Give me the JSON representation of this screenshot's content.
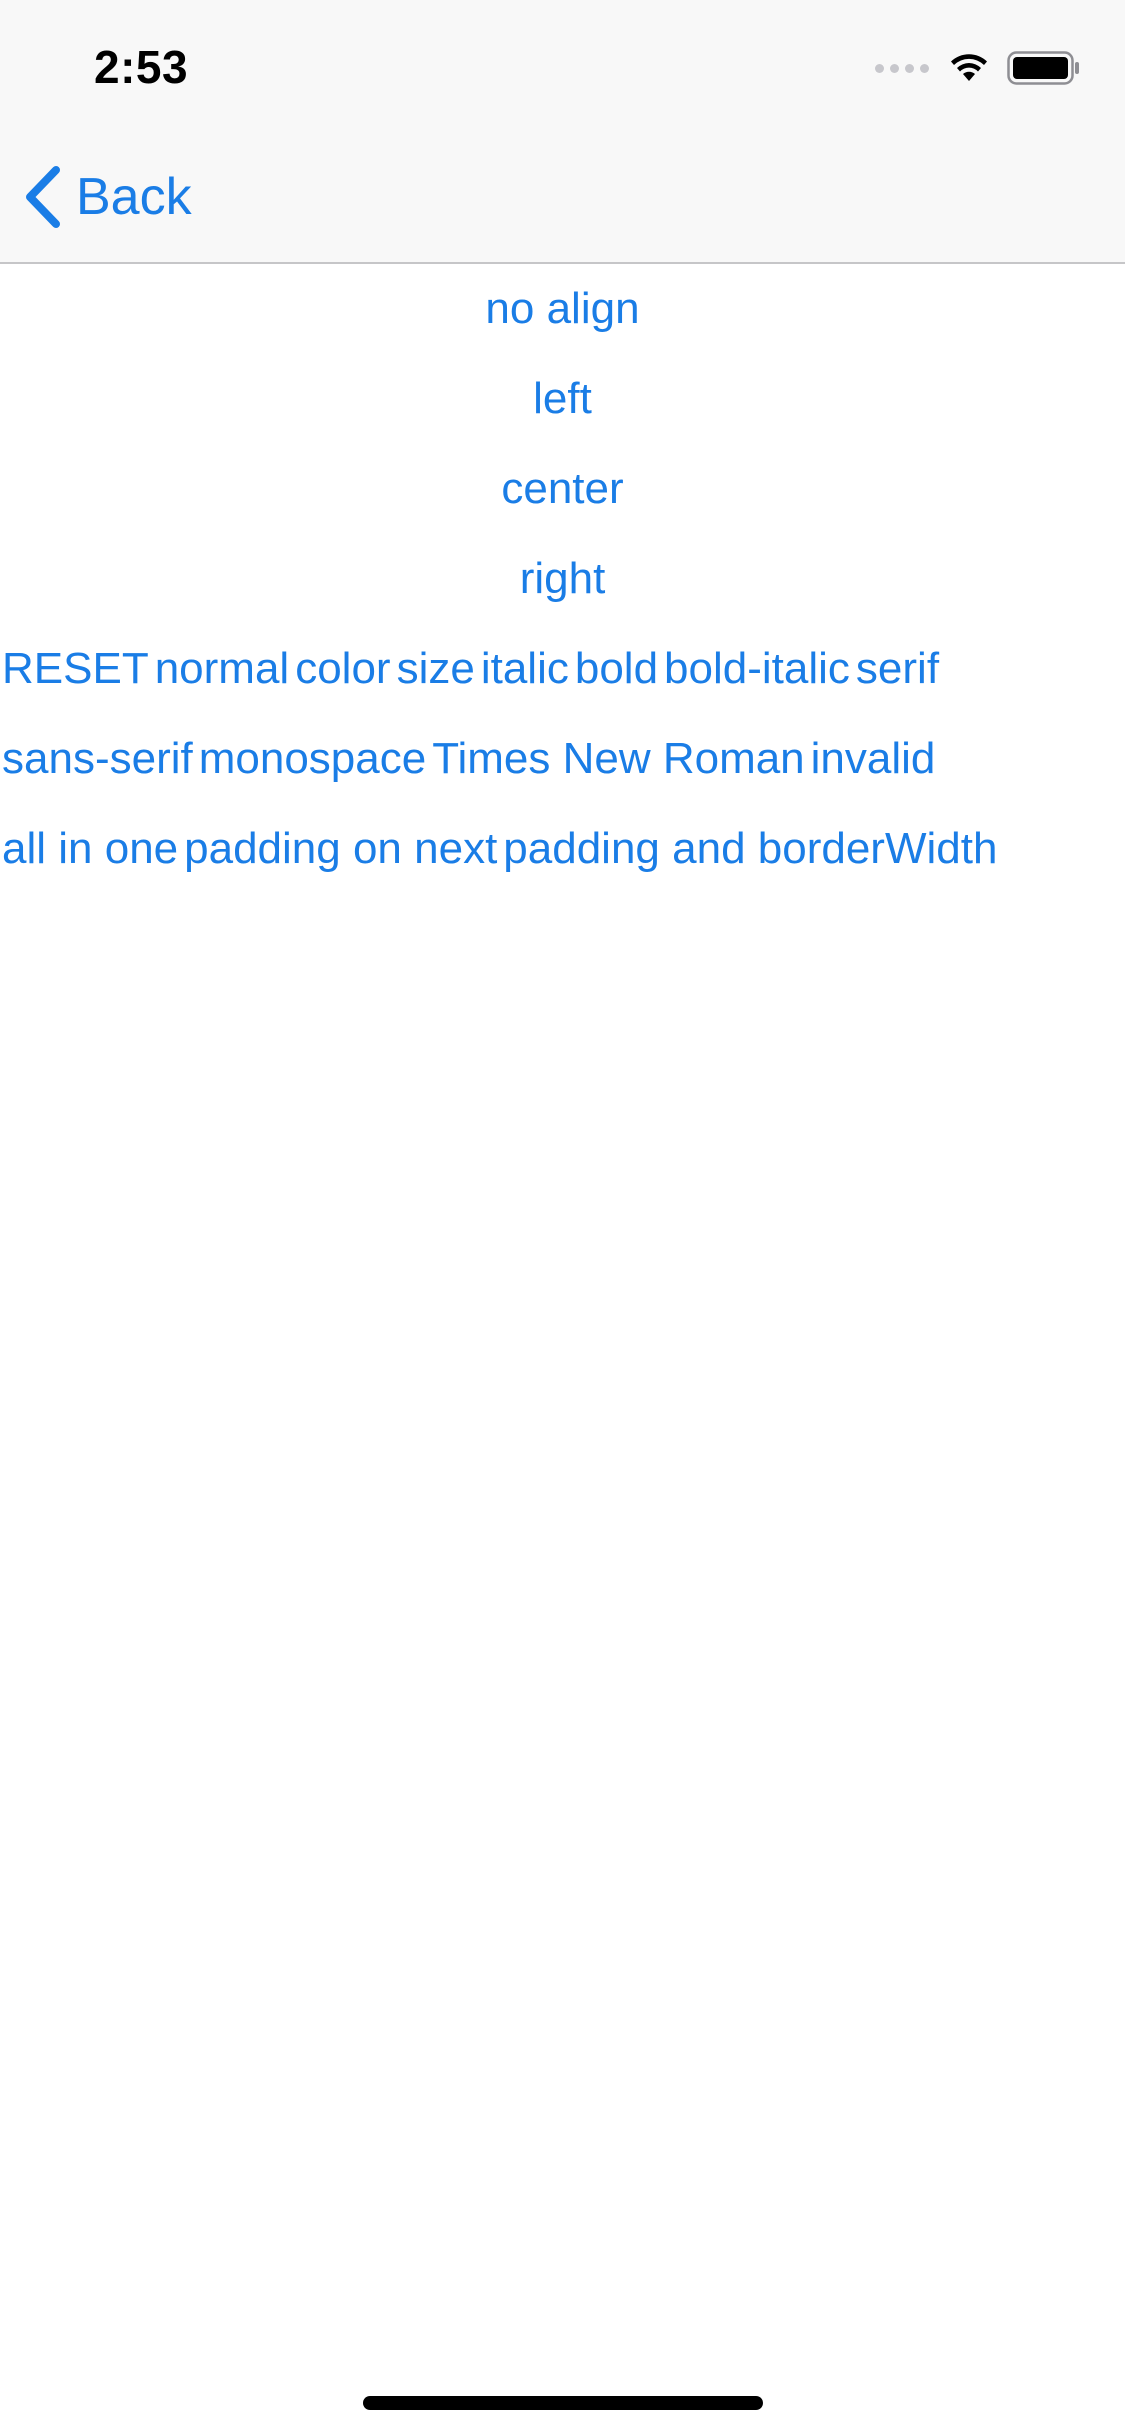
{
  "status_bar": {
    "time": "2:53"
  },
  "nav": {
    "back_label": "Back"
  },
  "rows": {
    "no_align": "no align",
    "left": "left",
    "center": "center",
    "right": "right"
  },
  "font_buttons_1": [
    "RESET",
    "normal",
    "color",
    "size",
    "italic",
    "bold",
    "bold-italic",
    "serif"
  ],
  "font_buttons_2": [
    "sans-serif",
    "monospace",
    "Times New Roman",
    "invalid"
  ],
  "font_buttons_3": [
    "all in one",
    "padding on next",
    "padding and borderWidth"
  ],
  "colors": {
    "accent": "#1a7de6",
    "navbar_bg": "#f8f8f8",
    "separator": "#c6c6c8"
  }
}
